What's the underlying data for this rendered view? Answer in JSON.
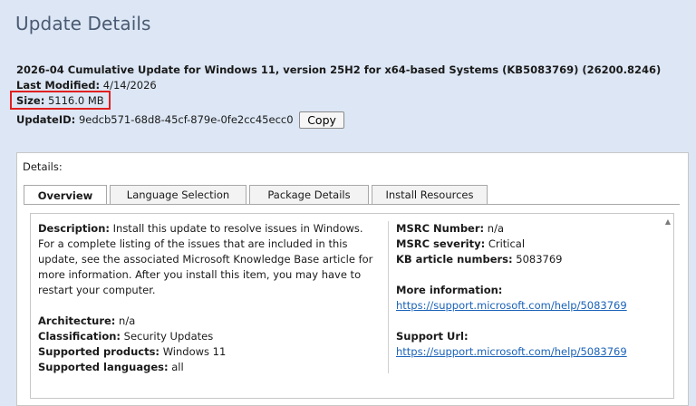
{
  "page": {
    "title": "Update Details"
  },
  "summary": {
    "update_title": "2026-04 Cumulative Update for Windows 11, version 25H2 for x64-based Systems (KB5083769) (26200.8246)",
    "last_modified_label": "Last Modified:",
    "last_modified_value": "4/14/2026",
    "size_label": "Size:",
    "size_value": "5116.0 MB",
    "update_id_label": "UpdateID:",
    "update_id_value": "9edcb571-68d8-45cf-879e-0fe2cc45ecc0",
    "copy_label": "Copy",
    "highlight_color": "#e02020"
  },
  "details": {
    "label": "Details:",
    "tabs": [
      "Overview",
      "Language Selection",
      "Package Details",
      "Install Resources"
    ],
    "active_tab": "Overview",
    "description_label": "Description:",
    "description_text": "Install this update to resolve issues in Windows. For a complete listing of the issues that are included in this update, see the associated Microsoft Knowledge Base article for more information. After you install this item, you may have to restart your computer.",
    "architecture_label": "Architecture:",
    "architecture_value": "n/a",
    "classification_label": "Classification:",
    "classification_value": "Security Updates",
    "supported_products_label": "Supported products:",
    "supported_products_value": "Windows 11",
    "supported_languages_label": "Supported languages:",
    "supported_languages_value": "all",
    "msrc_number_label": "MSRC Number:",
    "msrc_number_value": "n/a",
    "msrc_severity_label": "MSRC severity:",
    "msrc_severity_value": "Critical",
    "kb_label": "KB article numbers:",
    "kb_value": "5083769",
    "more_info_label": "More information:",
    "more_info_url": "https://support.microsoft.com/help/5083769",
    "support_url_label": "Support Url:",
    "support_url": "https://support.microsoft.com/help/5083769",
    "link_color": "#1a62b8"
  }
}
